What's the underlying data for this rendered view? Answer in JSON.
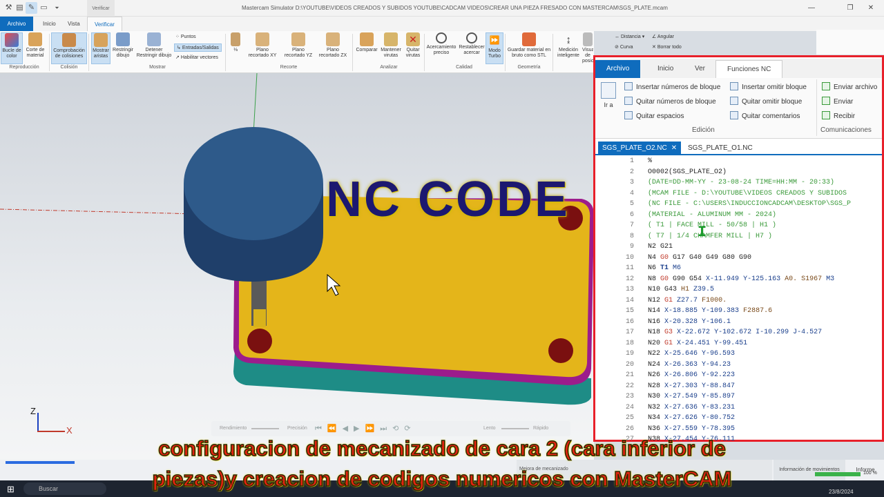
{
  "window": {
    "title": "Mastercam Simulator  D:\\YOUTUBE\\VIDEOS CREADOS Y SUBIDOS YOUTUBE\\CADCAM VIDEOS\\CREAR UNA PIEZA FRESADO CON MASTERCAM\\SGS_PLATE.mcam",
    "context_tab": "Verificar"
  },
  "ribbon_tabs": [
    "Archivo",
    "Inicio",
    "Vista",
    "Verificar"
  ],
  "ribbon": {
    "buttons": [
      {
        "label": "Bucle de color"
      },
      {
        "label": "Corte de material"
      },
      {
        "label": "Comprobación de colisiones"
      },
      {
        "label": "Mostrar aristas"
      },
      {
        "label": "Restringir dibujo"
      },
      {
        "label": "Detener Restringir dibujo"
      },
      {
        "label": "Plano recortado XY"
      },
      {
        "label": "Plano recortado YZ"
      },
      {
        "label": "Plano recortado ZX"
      },
      {
        "label": "Comparar"
      },
      {
        "label": "Mantener virutas"
      },
      {
        "label": "Quitar virutas"
      },
      {
        "label": "Acercamiento preciso"
      },
      {
        "label": "Restablecer acercar"
      },
      {
        "label": "Modo Turbo"
      },
      {
        "label": "Guardar material en bruto como STL"
      },
      {
        "label": "Medición inteligente"
      },
      {
        "label": "Visualización de posición"
      }
    ],
    "small_items": [
      "Puntos",
      "Entradas/Salidas",
      "Habilitar vectores",
      "Distancia",
      "Angular",
      "Curva",
      "Borrar todo"
    ],
    "groups": [
      "Reproducción",
      "Colisión",
      "Mostrar",
      "Recorte",
      "Analizar",
      "Calidad",
      "Geometría"
    ]
  },
  "viewport": {
    "overlay_title": "NC CODE",
    "triad": {
      "x": "X",
      "z": "Z"
    },
    "playbar": {
      "left": "Rendimiento",
      "mid": "Precisión",
      "slow": "Lento",
      "fast": "Rápido"
    }
  },
  "nc_editor": {
    "tabs": [
      "Archivo",
      "Inicio",
      "Ver",
      "Funciones NC"
    ],
    "commands": {
      "goto": "Ir a",
      "insert_block_numbers": "Insertar números de bloque",
      "remove_block_numbers": "Quitar números de bloque",
      "remove_spaces": "Quitar espacios",
      "insert_block_skip": "Insertar omitir bloque",
      "remove_block_skip": "Quitar omitir bloque",
      "remove_comments": "Quitar comentarios",
      "send_file": "Enviar archivo",
      "send": "Enviar",
      "receive": "Recibir"
    },
    "groups": {
      "edit": "Edición",
      "comms": "Comunicaciones"
    },
    "file_tabs": [
      "SGS_PLATE_O2.NC",
      "SGS_PLATE_O1.NC"
    ],
    "code_lines": [
      "%",
      "O0002(SGS_PLATE_O2)",
      "(DATE=DD-MM-YY - 23-08-24 TIME=HH:MM - 20:33)",
      "(MCAM FILE - D:\\YOUTUBE\\VIDEOS CREADOS Y SUBIDOS",
      "(NC FILE - C:\\USERS\\INDUCCIONCADCAM\\DESKTOP\\SGS_P",
      "(MATERIAL - ALUMINUM MM - 2024)",
      "( T1 | FACE MILL - 50/58 | H1 )",
      "( T7 | 1/4 CHAMFER MILL | H7 )",
      "N2 G21",
      "N4 G0 G17 G40 G49 G80 G90",
      "N6 T1 M6",
      "N8 G0 G90 G54 X-11.949 Y-125.163 A0. S1967 M3",
      "N10 G43 H1 Z39.5",
      "N12 G1 Z27.7 F1000.",
      "N14 X-18.885 Y-109.383 F2887.6",
      "N16 X-20.328 Y-106.1",
      "N18 G3 X-22.672 Y-102.672 I-10.299 J-4.527",
      "N20 G1 X-24.451 Y-99.451",
      "N22 X-25.646 Y-96.593",
      "N24 X-26.363 Y-94.23",
      "N26 X-26.806 Y-92.223",
      "N28 X-27.303 Y-88.847",
      "N30 X-27.549 Y-85.897",
      "N32 X-27.636 Y-83.231",
      "N34 X-27.626 Y-80.752",
      "N36 X-27.559 Y-78.395",
      "N38 X-27.454 Y-76.111"
    ]
  },
  "status": {
    "info": "Información de movimientos",
    "report": "Informe",
    "quality": "Mejora de mecanizado",
    "zoom": "100 %"
  },
  "taskbar": {
    "search": "Buscar",
    "date": "23/8/2024"
  },
  "caption": {
    "line1": "configuracion de mecanizado de cara 2 (cara inferior de",
    "line2": "piezas)y creacion de codigos numericos con MasterCAM"
  }
}
